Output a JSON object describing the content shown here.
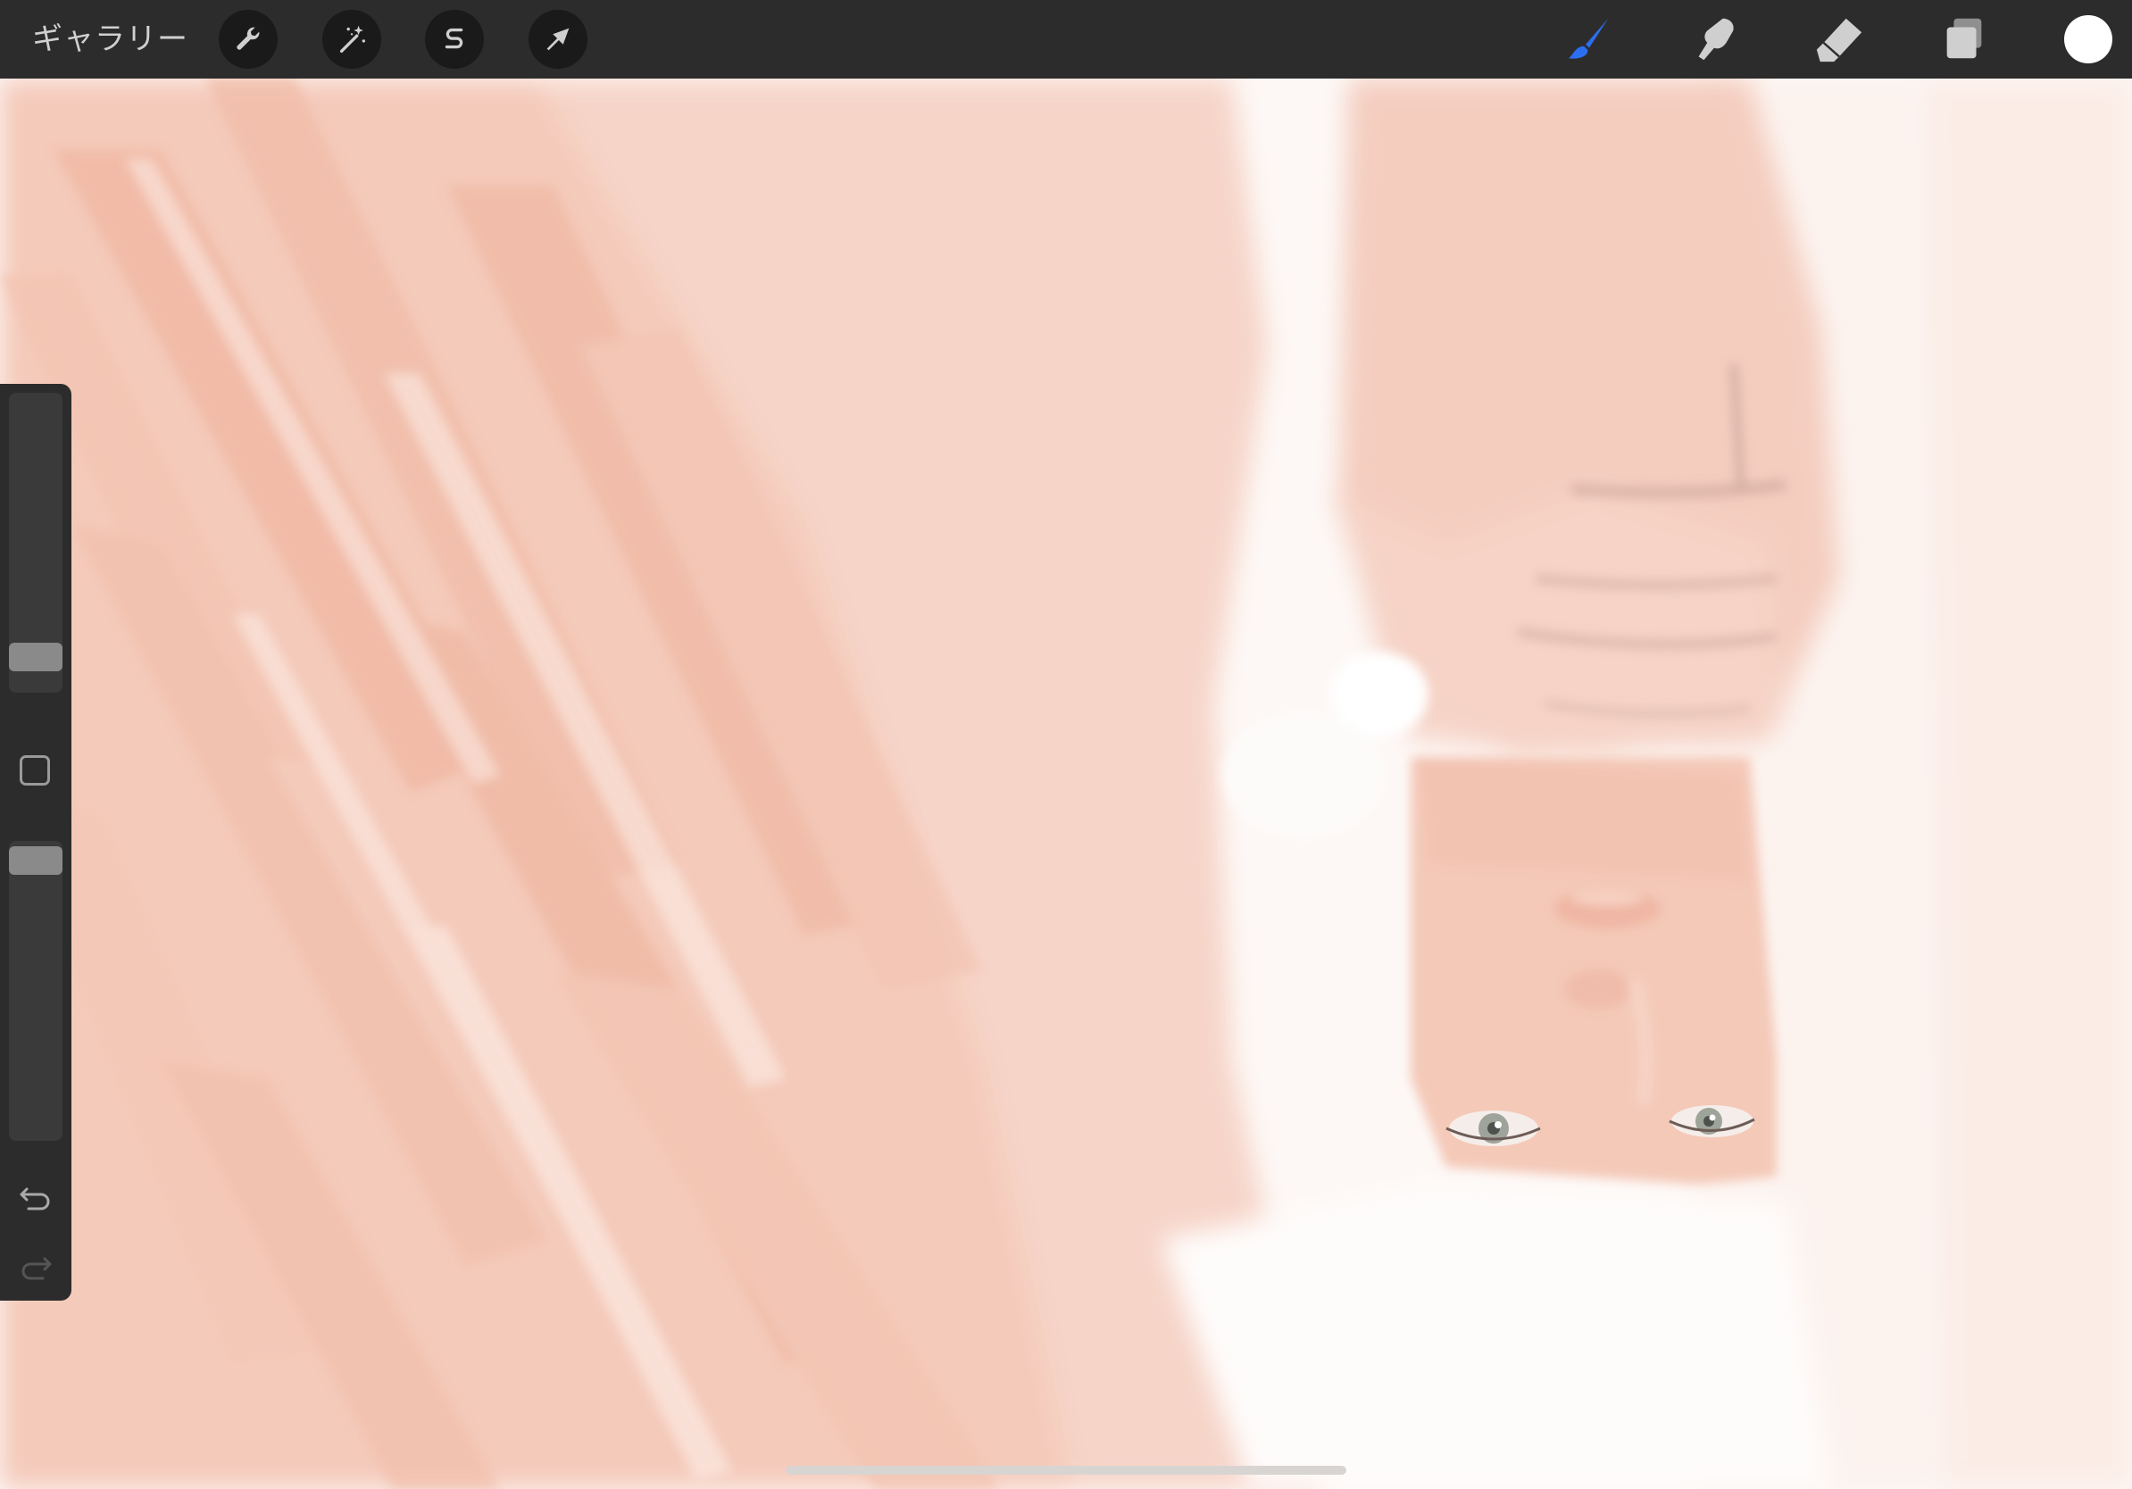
{
  "topbar": {
    "gallery_label": "ギャラリー",
    "left_tools": [
      {
        "name": "actions",
        "icon": "wrench-icon"
      },
      {
        "name": "adjustments",
        "icon": "magic-wand-icon"
      },
      {
        "name": "selection",
        "icon": "selection-s-icon"
      },
      {
        "name": "transform",
        "icon": "arrow-cursor-icon"
      }
    ],
    "right_tools": [
      {
        "name": "brush",
        "icon": "brush-icon",
        "active": true,
        "color": "#2b6ff0"
      },
      {
        "name": "smudge",
        "icon": "smudge-finger-icon",
        "active": false
      },
      {
        "name": "eraser",
        "icon": "eraser-icon",
        "active": false
      },
      {
        "name": "layers",
        "icon": "layers-icon",
        "active": false
      }
    ],
    "current_color": "#ffffff"
  },
  "sidebar": {
    "brush_size_level": 0.12,
    "brush_opacity_level": 0.96,
    "modify_button_icon": "square-modify-icon",
    "undo_icon": "undo-icon",
    "redo_icon": "redo-icon",
    "redo_enabled": false
  },
  "canvas": {
    "description_color_primary": "#f5c9b8"
  },
  "colors": {
    "bar_bg": "#2d2c2c",
    "tool_circle_bg": "#1a1a1a",
    "icon_light": "#cfcfcf",
    "brush_active": "#2b6ff0",
    "skin_tone": "#f2c6b4"
  }
}
